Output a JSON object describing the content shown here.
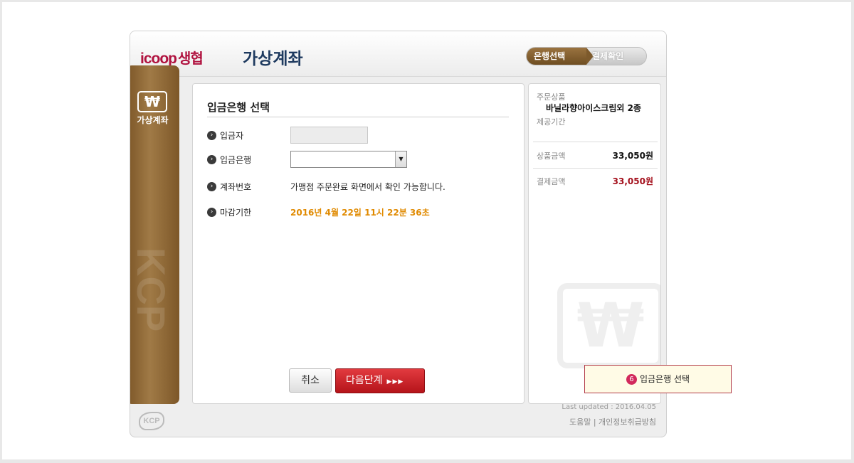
{
  "header": {
    "logo_brand": "icoop",
    "logo_korean": "생협",
    "title": "가상계좌"
  },
  "steps": [
    {
      "label": "은행선택",
      "active": true
    },
    {
      "label": "결제확인",
      "active": false
    }
  ],
  "sidebar": {
    "icon": "won-icon",
    "icon_glyph": "₩",
    "label": "가상계좌",
    "watermark": "KCP"
  },
  "form": {
    "title": "입금은행 선택",
    "depositor_label": "입금자",
    "depositor_value": "",
    "bank_label": "입금은행",
    "bank_selected": "",
    "account_label": "계좌번호",
    "account_value": "가맹점 주문완료 화면에서 확인 가능합니다.",
    "deadline_label": "마감기한",
    "deadline_value": "2016년 4월 22일 11시 22분 36초",
    "bullet_glyph": "›"
  },
  "buttons": {
    "cancel": "취소",
    "next": "다음단계",
    "next_arrows": "▶▶▶"
  },
  "summary": {
    "product_label": "주문상품",
    "product_name": "바닐라향아이스크림외 2종",
    "period_label": "제공기간",
    "price_label": "상품금액",
    "price_value": "33,050원",
    "payment_label": "결제금액",
    "payment_value": "33,050원",
    "watermark_glyph": "₩"
  },
  "footer": {
    "kcp_logo": "KCP",
    "last_updated": "Last updated : 2016.04.05",
    "links": "도움말 | 개인정보취급방침"
  },
  "tooltip": {
    "number": "6",
    "text": "입금은행 선택"
  },
  "colors": {
    "brand": "#b0123f",
    "sidebar": "#8b6332",
    "next_button": "#c8202a",
    "deadline": "#e08a00",
    "payment": "#a4101c"
  }
}
